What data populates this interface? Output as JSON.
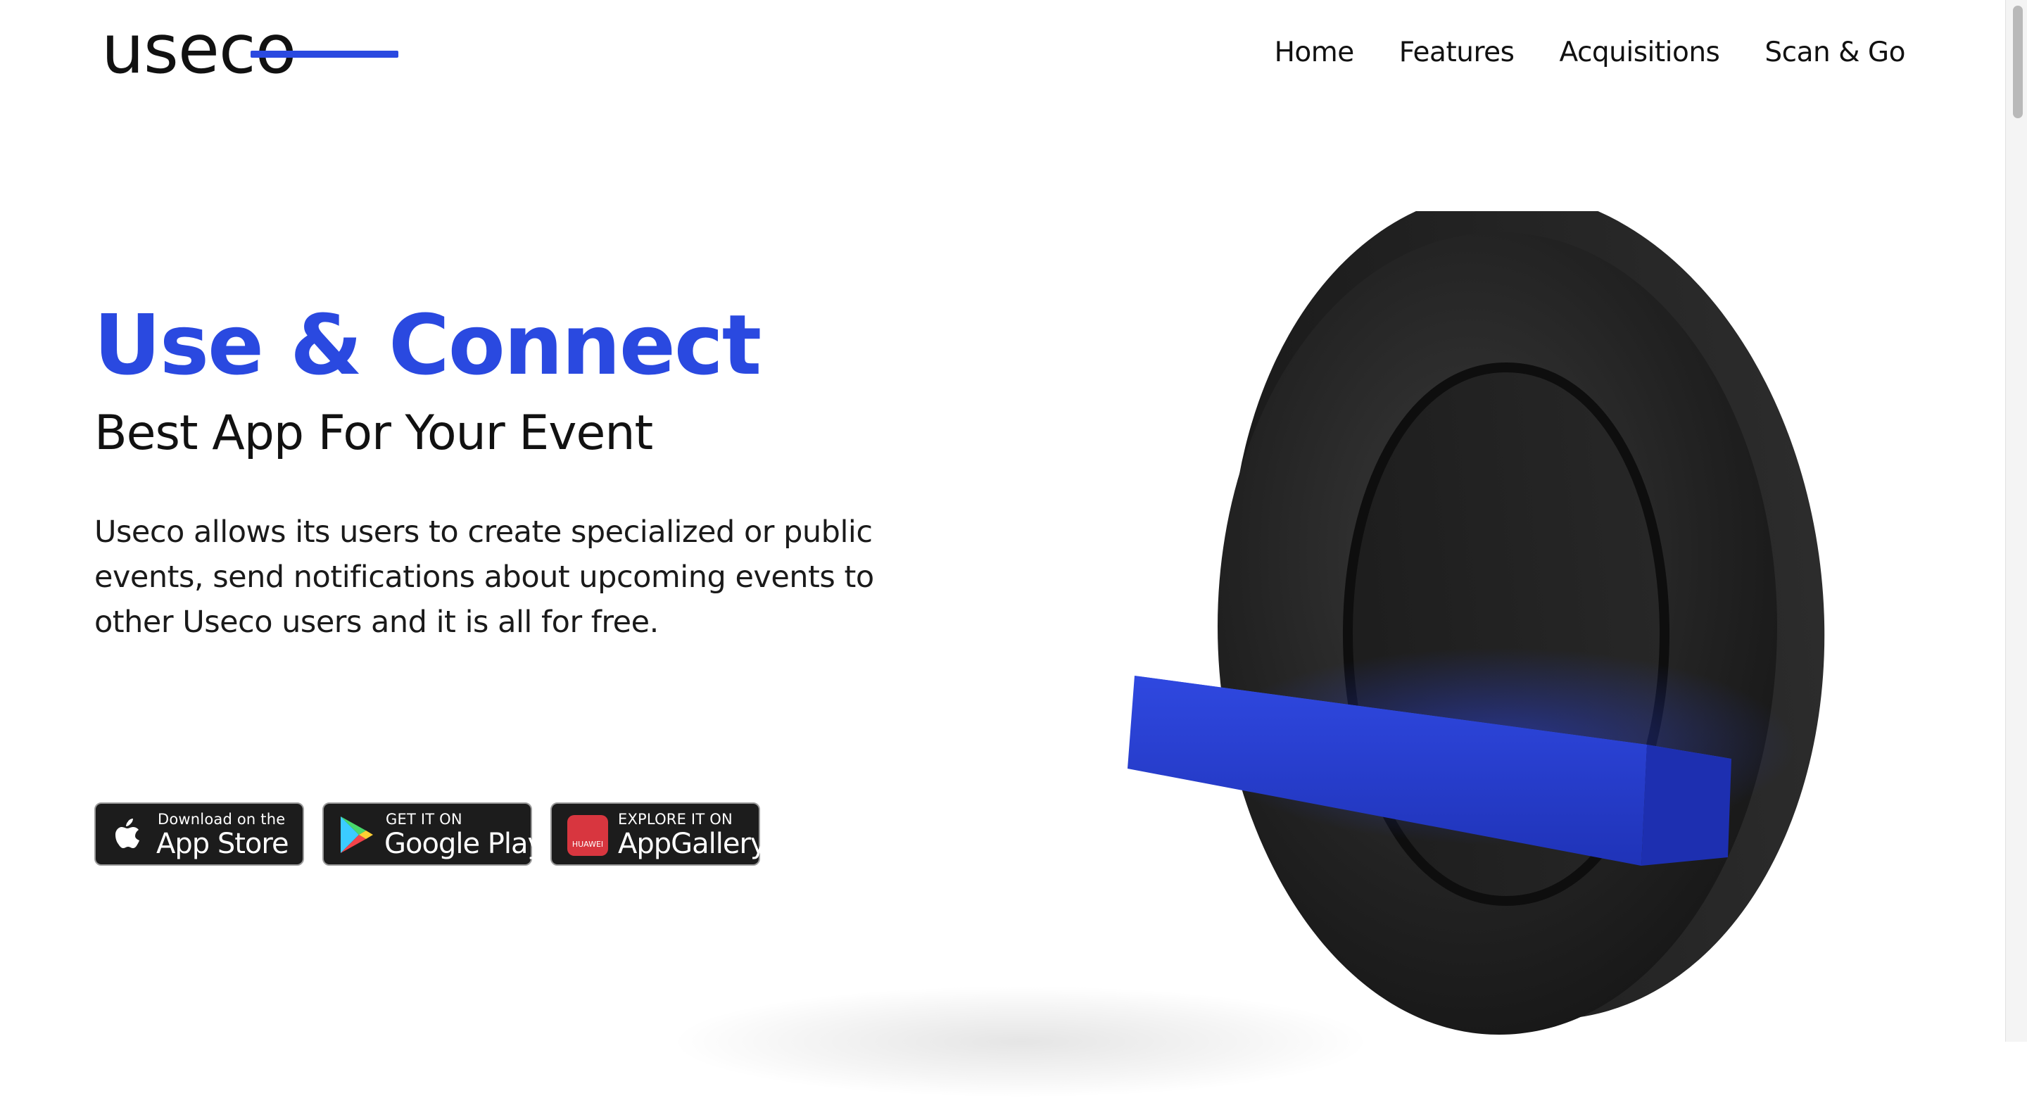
{
  "header": {
    "logo_text": "useco",
    "nav": [
      "Home",
      "Features",
      "Acquisitions",
      "Scan & Go"
    ]
  },
  "hero": {
    "title": "Use & Connect",
    "subtitle": "Best App For Your Event",
    "description": "Useco allows its users to create specialized or public events, send notifications about upcoming events to other Useco users and it is all for free."
  },
  "badges": {
    "appstore": {
      "small": "Download on the",
      "big": "App Store",
      "icon": "apple-icon"
    },
    "googleplay": {
      "small": "GET IT ON",
      "big": "Google Play",
      "icon": "google-play-icon"
    },
    "appgallery": {
      "small": "EXPLORE IT ON",
      "big": "AppGallery",
      "icon": "huawei-icon",
      "tile_text": "HUAWEI"
    }
  },
  "colors": {
    "accent": "#2a49e0",
    "ring": "#1f1f1f",
    "badge_bg": "#1c1c1c"
  }
}
